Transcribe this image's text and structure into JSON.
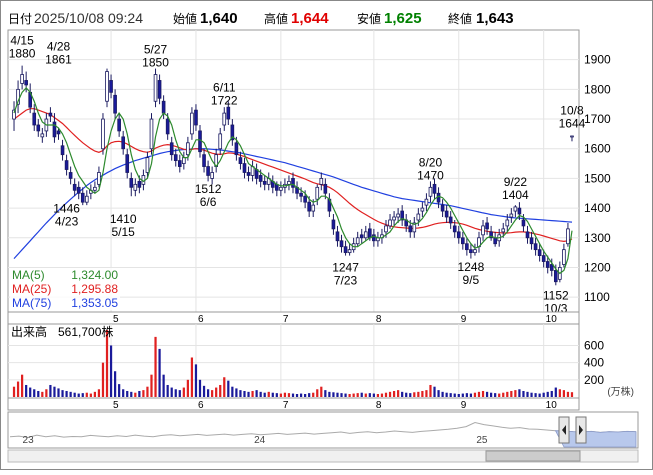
{
  "header": {
    "date_label": "日付",
    "datetime": "2025/10/08 09:24",
    "open_label": "始値",
    "open": "1,640",
    "high_label": "高値",
    "high": "1,644",
    "low_label": "安値",
    "low": "1,625",
    "close_label": "終値",
    "close": "1,643"
  },
  "colors": {
    "up": "#ffffff",
    "down": "#1a1a9a",
    "ma5": "#2d8a2d",
    "ma25": "#e02020",
    "ma75": "#2040e0",
    "high_value": "#e00000",
    "low_value": "#008000",
    "volume_up": "#e02020",
    "volume_down": "#1a1a9a",
    "nav_fill": "#b8c8ec"
  },
  "legend": {
    "ma5_label": "MA(5)",
    "ma5_value": "1,324.00",
    "ma25_label": "MA(25)",
    "ma25_value": "1,295.88",
    "ma75_label": "MA(75)",
    "ma75_value": "1,353.05"
  },
  "volume": {
    "label": "出来高",
    "value": "561,700株",
    "unit": "(万株)"
  },
  "chart_data": {
    "type": "candlestick",
    "price_ylim": [
      1050,
      2000
    ],
    "price_ticks": [
      "1100",
      "1200",
      "1300",
      "1400",
      "1500",
      "1600",
      "1700",
      "1800",
      "1900"
    ],
    "month_ticks": [
      {
        "label": "5",
        "index": 24
      },
      {
        "label": "6",
        "index": 45
      },
      {
        "label": "7",
        "index": 66
      },
      {
        "label": "8",
        "index": 89
      },
      {
        "label": "9",
        "index": 110
      },
      {
        "label": "10",
        "index": 131
      }
    ],
    "volume_ylim": [
      0,
      850
    ],
    "volume_ticks": [
      "200",
      "400",
      "600"
    ],
    "close": [
      1730,
      1800,
      1850,
      1815,
      1740,
      1680,
      1660,
      1650,
      1700,
      1710,
      1640,
      1650,
      1580,
      1530,
      1500,
      1460,
      1450,
      1420,
      1440,
      1460,
      1470,
      1520,
      1700,
      1860,
      1790,
      1720,
      1660,
      1600,
      1520,
      1470,
      1480,
      1470,
      1510,
      1570,
      1700,
      1850,
      1770,
      1720,
      1650,
      1580,
      1560,
      1540,
      1570,
      1620,
      1720,
      1680,
      1590,
      1540,
      1510,
      1520,
      1580,
      1650,
      1720,
      1700,
      1630,
      1580,
      1550,
      1520,
      1510,
      1540,
      1500,
      1490,
      1480,
      1500,
      1470,
      1460,
      1470,
      1480,
      1490,
      1470,
      1450,
      1440,
      1420,
      1390,
      1410,
      1470,
      1500,
      1450,
      1390,
      1330,
      1290,
      1270,
      1250,
      1260,
      1280,
      1300,
      1300,
      1320,
      1300,
      1290,
      1300,
      1310,
      1340,
      1360,
      1370,
      1380,
      1360,
      1340,
      1320,
      1350,
      1380,
      1400,
      1430,
      1470,
      1450,
      1420,
      1390,
      1370,
      1350,
      1320,
      1300,
      1280,
      1260,
      1250,
      1260,
      1300,
      1340,
      1330,
      1300,
      1280,
      1310,
      1330,
      1360,
      1380,
      1404,
      1380,
      1340,
      1300,
      1280,
      1260,
      1240,
      1220,
      1200,
      1190,
      1152,
      1200,
      1260,
      1330,
      1643
    ],
    "open": [
      1700,
      1750,
      1820,
      1830,
      1790,
      1720,
      1680,
      1640,
      1660,
      1720,
      1690,
      1660,
      1610,
      1560,
      1520,
      1480,
      1470,
      1450,
      1420,
      1450,
      1460,
      1480,
      1600,
      1760,
      1830,
      1780,
      1700,
      1640,
      1580,
      1500,
      1460,
      1490,
      1480,
      1520,
      1600,
      1760,
      1830,
      1760,
      1700,
      1620,
      1580,
      1560,
      1550,
      1580,
      1650,
      1730,
      1660,
      1580,
      1540,
      1500,
      1540,
      1600,
      1680,
      1740,
      1680,
      1620,
      1570,
      1550,
      1520,
      1510,
      1530,
      1510,
      1490,
      1480,
      1490,
      1480,
      1460,
      1470,
      1480,
      1500,
      1470,
      1450,
      1440,
      1420,
      1390,
      1430,
      1480,
      1480,
      1430,
      1360,
      1320,
      1290,
      1270,
      1250,
      1260,
      1280,
      1310,
      1300,
      1330,
      1310,
      1290,
      1300,
      1320,
      1340,
      1360,
      1370,
      1390,
      1360,
      1340,
      1320,
      1360,
      1390,
      1410,
      1440,
      1480,
      1450,
      1410,
      1390,
      1370,
      1340,
      1320,
      1300,
      1280,
      1260,
      1250,
      1270,
      1310,
      1350,
      1320,
      1300,
      1290,
      1320,
      1340,
      1370,
      1390,
      1400,
      1360,
      1320,
      1300,
      1280,
      1260,
      1240,
      1220,
      1210,
      1190,
      1160,
      1210,
      1280,
      1640
    ],
    "high": [
      1760,
      1830,
      1880,
      1860,
      1820,
      1750,
      1700,
      1670,
      1720,
      1740,
      1720,
      1670,
      1630,
      1580,
      1540,
      1500,
      1490,
      1470,
      1460,
      1480,
      1490,
      1540,
      1720,
      1870,
      1850,
      1800,
      1720,
      1660,
      1600,
      1520,
      1500,
      1510,
      1530,
      1590,
      1720,
      1870,
      1850,
      1780,
      1720,
      1640,
      1600,
      1580,
      1590,
      1640,
      1740,
      1750,
      1680,
      1600,
      1560,
      1540,
      1600,
      1670,
      1740,
      1760,
      1700,
      1640,
      1590,
      1570,
      1540,
      1560,
      1550,
      1530,
      1510,
      1520,
      1510,
      1490,
      1490,
      1500,
      1510,
      1520,
      1490,
      1470,
      1460,
      1440,
      1430,
      1480,
      1520,
      1500,
      1450,
      1380,
      1340,
      1310,
      1290,
      1280,
      1300,
      1320,
      1330,
      1340,
      1350,
      1330,
      1320,
      1330,
      1360,
      1380,
      1390,
      1400,
      1410,
      1380,
      1360,
      1370,
      1400,
      1420,
      1450,
      1490,
      1500,
      1470,
      1430,
      1410,
      1390,
      1360,
      1340,
      1320,
      1300,
      1280,
      1280,
      1320,
      1360,
      1370,
      1340,
      1320,
      1330,
      1350,
      1380,
      1400,
      1410,
      1420,
      1380,
      1340,
      1320,
      1300,
      1280,
      1260,
      1240,
      1230,
      1210,
      1220,
      1280,
      1350,
      1644
    ],
    "low": [
      1660,
      1720,
      1800,
      1790,
      1720,
      1660,
      1640,
      1620,
      1640,
      1690,
      1620,
      1630,
      1560,
      1510,
      1480,
      1440,
      1430,
      1410,
      1410,
      1430,
      1450,
      1470,
      1580,
      1740,
      1770,
      1700,
      1640,
      1580,
      1500,
      1440,
      1440,
      1450,
      1460,
      1500,
      1580,
      1740,
      1750,
      1700,
      1630,
      1560,
      1540,
      1520,
      1530,
      1560,
      1630,
      1660,
      1570,
      1520,
      1490,
      1480,
      1520,
      1580,
      1660,
      1680,
      1610,
      1560,
      1530,
      1500,
      1490,
      1490,
      1480,
      1470,
      1460,
      1460,
      1450,
      1440,
      1440,
      1450,
      1460,
      1450,
      1430,
      1420,
      1400,
      1370,
      1370,
      1410,
      1460,
      1430,
      1370,
      1310,
      1270,
      1250,
      1240,
      1240,
      1250,
      1270,
      1280,
      1290,
      1290,
      1270,
      1270,
      1280,
      1300,
      1330,
      1340,
      1350,
      1340,
      1320,
      1300,
      1300,
      1340,
      1370,
      1390,
      1420,
      1430,
      1400,
      1370,
      1350,
      1330,
      1300,
      1280,
      1260,
      1240,
      1230,
      1240,
      1250,
      1290,
      1310,
      1290,
      1270,
      1270,
      1300,
      1320,
      1350,
      1370,
      1360,
      1320,
      1280,
      1260,
      1240,
      1220,
      1200,
      1180,
      1170,
      1140,
      1150,
      1200,
      1270,
      1625
    ],
    "volume": [
      120,
      180,
      260,
      140,
      110,
      90,
      70,
      60,
      90,
      140,
      120,
      100,
      80,
      70,
      60,
      50,
      40,
      45,
      50,
      40,
      60,
      90,
      400,
      780,
      600,
      300,
      150,
      90,
      70,
      60,
      50,
      70,
      80,
      120,
      260,
      700,
      560,
      260,
      140,
      110,
      90,
      80,
      110,
      200,
      460,
      380,
      200,
      130,
      90,
      80,
      110,
      140,
      230,
      190,
      120,
      100,
      80,
      70,
      60,
      70,
      80,
      60,
      50,
      60,
      50,
      45,
      40,
      50,
      45,
      40,
      35,
      40,
      35,
      45,
      50,
      90,
      120,
      80,
      60,
      55,
      50,
      45,
      40,
      35,
      40,
      45,
      50,
      40,
      45,
      40,
      35,
      40,
      50,
      60,
      70,
      80,
      60,
      50,
      45,
      55,
      60,
      70,
      80,
      140,
      120,
      80,
      60,
      50,
      45,
      40,
      35,
      40,
      45,
      40,
      50,
      60,
      70,
      60,
      50,
      45,
      40,
      50,
      60,
      70,
      80,
      90,
      70,
      60,
      50,
      45,
      40,
      50,
      60,
      70,
      110,
      90,
      80,
      60,
      56
    ],
    "ma5": [
      1720,
      1760,
      1790,
      1805,
      1790,
      1760,
      1720,
      1690,
      1680,
      1680,
      1680,
      1670,
      1650,
      1620,
      1580,
      1540,
      1510,
      1490,
      1470,
      1460,
      1450,
      1460,
      1520,
      1600,
      1660,
      1700,
      1720,
      1700,
      1650,
      1580,
      1530,
      1500,
      1490,
      1500,
      1550,
      1640,
      1700,
      1720,
      1710,
      1680,
      1630,
      1590,
      1570,
      1570,
      1600,
      1630,
      1630,
      1620,
      1590,
      1560,
      1540,
      1560,
      1590,
      1620,
      1640,
      1630,
      1610,
      1580,
      1550,
      1540,
      1530,
      1520,
      1510,
      1500,
      1490,
      1480,
      1475,
      1475,
      1478,
      1480,
      1470,
      1460,
      1450,
      1430,
      1420,
      1425,
      1440,
      1440,
      1430,
      1400,
      1370,
      1330,
      1300,
      1280,
      1270,
      1270,
      1280,
      1290,
      1300,
      1305,
      1300,
      1300,
      1310,
      1320,
      1340,
      1355,
      1365,
      1360,
      1350,
      1345,
      1350,
      1365,
      1385,
      1410,
      1430,
      1440,
      1435,
      1420,
      1400,
      1375,
      1350,
      1325,
      1300,
      1280,
      1265,
      1270,
      1285,
      1300,
      1305,
      1300,
      1300,
      1305,
      1320,
      1340,
      1360,
      1375,
      1370,
      1355,
      1330,
      1305,
      1280,
      1255,
      1235,
      1215,
      1195,
      1180,
      1190,
      1230,
      1324
    ],
    "ma25": [
      1700,
      1710,
      1720,
      1730,
      1735,
      1735,
      1730,
      1725,
      1720,
      1715,
      1705,
      1695,
      1685,
      1672,
      1658,
      1645,
      1632,
      1620,
      1610,
      1600,
      1592,
      1588,
      1594,
      1610,
      1620,
      1624,
      1625,
      1622,
      1616,
      1608,
      1600,
      1594,
      1590,
      1588,
      1592,
      1602,
      1608,
      1612,
      1614,
      1612,
      1608,
      1603,
      1598,
      1596,
      1598,
      1600,
      1598,
      1595,
      1590,
      1585,
      1582,
      1581,
      1583,
      1586,
      1585,
      1582,
      1578,
      1574,
      1568,
      1563,
      1558,
      1553,
      1548,
      1543,
      1538,
      1533,
      1528,
      1523,
      1518,
      1513,
      1508,
      1503,
      1498,
      1492,
      1486,
      1482,
      1479,
      1475,
      1470,
      1462,
      1452,
      1440,
      1428,
      1416,
      1405,
      1395,
      1386,
      1378,
      1370,
      1362,
      1355,
      1349,
      1344,
      1340,
      1337,
      1335,
      1334,
      1333,
      1332,
      1332,
      1333,
      1335,
      1338,
      1342,
      1346,
      1349,
      1351,
      1352,
      1352,
      1351,
      1349,
      1346,
      1342,
      1337,
      1332,
      1328,
      1325,
      1322,
      1320,
      1318,
      1317,
      1316,
      1316,
      1317,
      1319,
      1320,
      1320,
      1318,
      1316,
      1313,
      1310,
      1306,
      1302,
      1298,
      1294,
      1290,
      1288,
      1290,
      1296
    ],
    "ma75": [
      1230,
      1245,
      1260,
      1275,
      1290,
      1305,
      1320,
      1335,
      1350,
      1364,
      1378,
      1392,
      1405,
      1418,
      1430,
      1442,
      1454,
      1465,
      1476,
      1486,
      1495,
      1503,
      1511,
      1519,
      1526,
      1533,
      1539,
      1545,
      1550,
      1555,
      1560,
      1564,
      1568,
      1572,
      1576,
      1580,
      1584,
      1587,
      1590,
      1592,
      1594,
      1596,
      1597,
      1598,
      1599,
      1600,
      1600,
      1600,
      1599,
      1598,
      1597,
      1596,
      1594,
      1592,
      1590,
      1588,
      1586,
      1583,
      1580,
      1577,
      1574,
      1571,
      1568,
      1565,
      1562,
      1559,
      1556,
      1553,
      1549,
      1545,
      1541,
      1537,
      1533,
      1529,
      1525,
      1521,
      1517,
      1513,
      1509,
      1505,
      1500,
      1495,
      1490,
      1485,
      1480,
      1475,
      1470,
      1466,
      1462,
      1458,
      1454,
      1450,
      1446,
      1442,
      1438,
      1435,
      1432,
      1430,
      1428,
      1426,
      1424,
      1422,
      1420,
      1418,
      1416,
      1414,
      1412,
      1410,
      1408,
      1405,
      1402,
      1399,
      1396,
      1393,
      1390,
      1387,
      1384,
      1381,
      1378,
      1376,
      1374,
      1372,
      1370,
      1368,
      1367,
      1366,
      1365,
      1364,
      1363,
      1362,
      1361,
      1360,
      1359,
      1358,
      1357,
      1356,
      1355,
      1354,
      1353
    ],
    "annotations": [
      {
        "date": "4/15",
        "price": "1880",
        "index": 2,
        "pos": "above",
        "value": 1880
      },
      {
        "date": "4/28",
        "price": "1861",
        "index": 11,
        "pos": "above",
        "value": 1861
      },
      {
        "date": "5/27",
        "price": "1850",
        "index": 35,
        "pos": "above",
        "value": 1850
      },
      {
        "date": "6/11",
        "price": "1722",
        "index": 52,
        "pos": "above",
        "value": 1722
      },
      {
        "date": "8/20",
        "price": "1470",
        "index": 103,
        "pos": "above",
        "value": 1470
      },
      {
        "date": "9/22",
        "price": "1404",
        "index": 124,
        "pos": "above",
        "value": 1404
      },
      {
        "date": "10/8",
        "price": "1644",
        "index": 138,
        "pos": "above",
        "value": 1644
      },
      {
        "date": "4/23",
        "price": "1446",
        "index": 13,
        "pos": "below",
        "value": 1446
      },
      {
        "date": "5/15",
        "price": "1410",
        "index": 27,
        "pos": "below",
        "value": 1410
      },
      {
        "date": "6/6",
        "price": "1512",
        "index": 48,
        "pos": "below",
        "value": 1512
      },
      {
        "date": "7/23",
        "price": "1247",
        "index": 82,
        "pos": "below",
        "value": 1247
      },
      {
        "date": "9/5",
        "price": "1248",
        "index": 113,
        "pos": "below",
        "value": 1248
      },
      {
        "date": "10/3",
        "price": "1152",
        "index": 134,
        "pos": "below",
        "value": 1152
      }
    ],
    "navigator": {
      "labels": [
        {
          "text": "23",
          "pos": 0.02
        },
        {
          "text": "24",
          "pos": 0.39
        },
        {
          "text": "25",
          "pos": 0.745
        }
      ],
      "series": [
        0.3,
        0.32,
        0.28,
        0.35,
        0.3,
        0.33,
        0.29,
        0.31,
        0.3,
        0.34,
        0.32,
        0.3,
        0.33,
        0.31,
        0.35,
        0.32,
        0.3,
        0.34,
        0.36,
        0.33,
        0.35,
        0.37,
        0.34,
        0.36,
        0.38,
        0.35,
        0.37,
        0.39,
        0.36,
        0.38,
        0.4,
        0.37,
        0.39,
        0.41,
        0.38,
        0.4,
        0.42,
        0.44,
        0.4,
        0.43,
        0.45,
        0.42,
        0.44,
        0.47,
        0.45,
        0.43,
        0.46,
        0.48,
        0.5,
        0.52,
        0.55,
        0.6,
        0.72,
        0.66,
        0.62,
        0.58,
        0.55,
        0.57,
        0.53,
        0.52,
        0.5,
        0.48,
        0.47,
        0.45,
        0.44,
        0.46,
        0.43,
        0.45,
        0.44,
        0.46,
        0.45
      ],
      "window_start": 0.885
    }
  }
}
